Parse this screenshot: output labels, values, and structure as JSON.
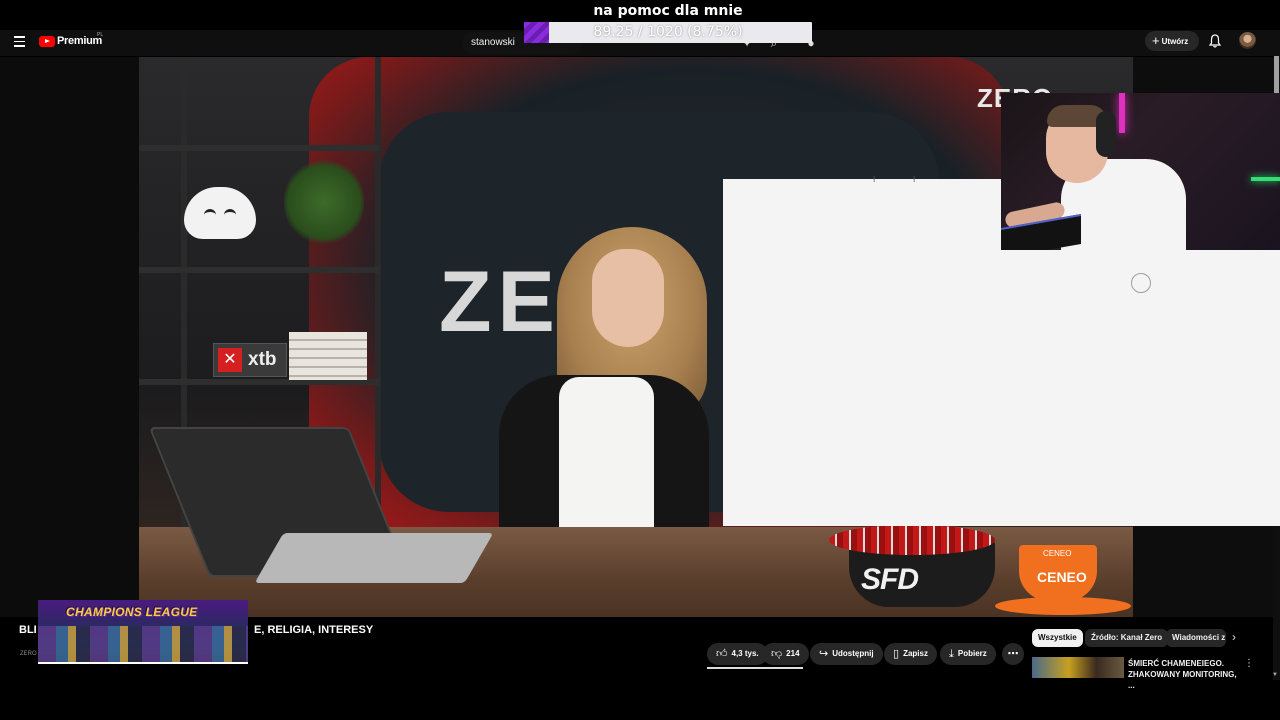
{
  "stream_goal": {
    "title": "na pomoc dla mnie",
    "progress_text": "89.25 / 1020 (8.75%)",
    "progress_fraction": 0.0875,
    "fill_color": "#8a2be2"
  },
  "header": {
    "brand": "Premium",
    "region": "PL",
    "search_value": "stanowski",
    "create_label": "Utwórz"
  },
  "video": {
    "wall_logo": "ZERO",
    "corner_logo": "ZERO",
    "small_logo": "ZERO",
    "shelf_brand": "xtb",
    "bowl_brand": "SFD",
    "mug_brand": "CENEO"
  },
  "title_row": {
    "start": "BLI",
    "end": "E, RELIGIA, INTERESY"
  },
  "overlay": {
    "champions_text": "CHAMPIONS LEAGUE"
  },
  "actions": {
    "likes": "4,3 tys.",
    "dislikes": "214",
    "share": "Udostępnij",
    "save": "Zapisz",
    "download": "Pobierz"
  },
  "chips": [
    "Wszystkie",
    "Źródło: Kanał Zero",
    "Wiadomości z"
  ],
  "recommendation": {
    "title": "ŚMIERĆ CHAMENEIEGO. ZHAKOWANY MONITORING, ..."
  },
  "colors": {
    "youtube_red": "#ff0000",
    "header_bg": "#0f0f0f",
    "chip_bg": "#272727"
  }
}
